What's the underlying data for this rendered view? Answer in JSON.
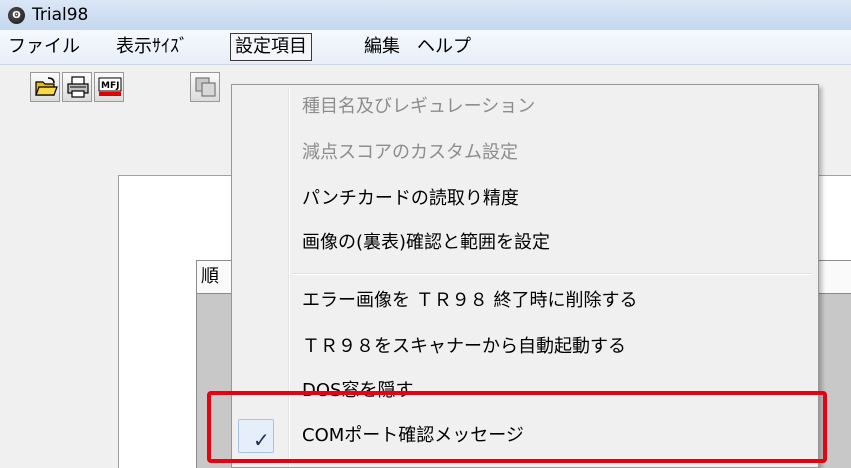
{
  "window": {
    "title": "Trial98"
  },
  "menubar": {
    "items": [
      {
        "label": "ファイル"
      },
      {
        "label": "表示ｻｲｽﾞ"
      },
      {
        "label": "設定項目"
      },
      {
        "label": "編集"
      },
      {
        "label": "ヘルプ"
      }
    ],
    "active_index": 2
  },
  "toolbar": {
    "buttons": [
      {
        "icon": "open-folder-icon"
      },
      {
        "icon": "printer-icon"
      },
      {
        "icon": "mfj-icon",
        "text": "MFJ"
      },
      {
        "icon": "copy-icon"
      }
    ]
  },
  "grid": {
    "header_cell": "順"
  },
  "dropdown": {
    "items": [
      {
        "label": "種目名及びレギュレーション",
        "enabled": false,
        "checked": false
      },
      {
        "label": "減点スコアのカスタム設定",
        "enabled": false,
        "checked": false
      },
      {
        "label": "パンチカードの読取り精度",
        "enabled": true,
        "checked": false
      },
      {
        "label": "画像の(裏表)確認と範囲を設定",
        "enabled": true,
        "checked": false
      },
      {
        "label": "エラー画像を ＴＲ９８ 終了時に削除する",
        "enabled": true,
        "checked": false
      },
      {
        "label": "ＴＲ９８をスキャナーから自動起動する",
        "enabled": true,
        "checked": false
      },
      {
        "label": "DOS窓を隠す",
        "enabled": true,
        "checked": false
      },
      {
        "label": "COMポート確認メッセージ",
        "enabled": true,
        "checked": true
      }
    ],
    "check_glyph": "✓"
  },
  "colors": {
    "highlight": "#e60012",
    "disabled_text": "#8d8d8d"
  }
}
